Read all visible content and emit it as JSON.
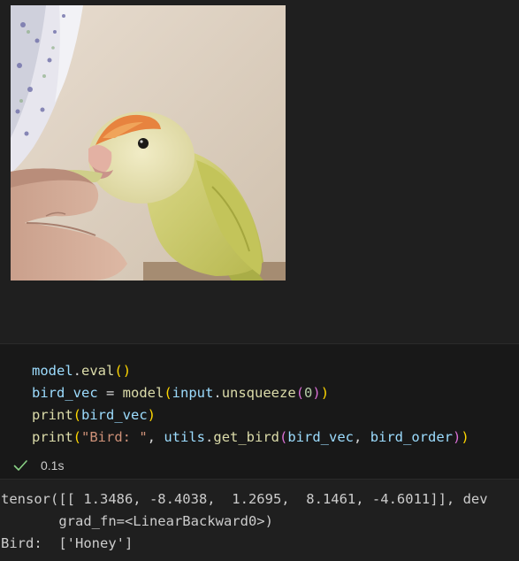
{
  "image_output": {
    "description_icon": "bird-photo"
  },
  "code_cell": {
    "line1": {
      "obj": "model",
      "dot": ".",
      "fn": "eval",
      "open": "(",
      "close": ")"
    },
    "line2": {
      "var": "bird_vec",
      "eq": " = ",
      "fn": "model",
      "open": "(",
      "arg_obj": "input",
      "dot": ".",
      "arg_fn": "unsqueeze",
      "open2": "(",
      "num": "0",
      "close2": ")",
      "close": ")"
    },
    "line3": {
      "fn": "print",
      "open": "(",
      "arg": "bird_vec",
      "close": ")"
    },
    "line4": {
      "fn": "print",
      "open": "(",
      "str": "\"Bird: \"",
      "comma": ", ",
      "mod": "utils",
      "dot": ".",
      "fn2": "get_bird",
      "open2": "(",
      "arg1": "bird_vec",
      "comma2": ", ",
      "arg2": "bird_order",
      "close2": ")",
      "close": ")"
    }
  },
  "status": {
    "icon": "check-icon",
    "duration": "0.1s",
    "color": "#89d185"
  },
  "output": {
    "line1": "tensor([[ 1.3486, -8.4038,  1.2695,  8.1461, -4.6011]], dev",
    "line2": "       grad_fn=<LinearBackward0>)",
    "line3": "Bird:  ['Honey']"
  }
}
